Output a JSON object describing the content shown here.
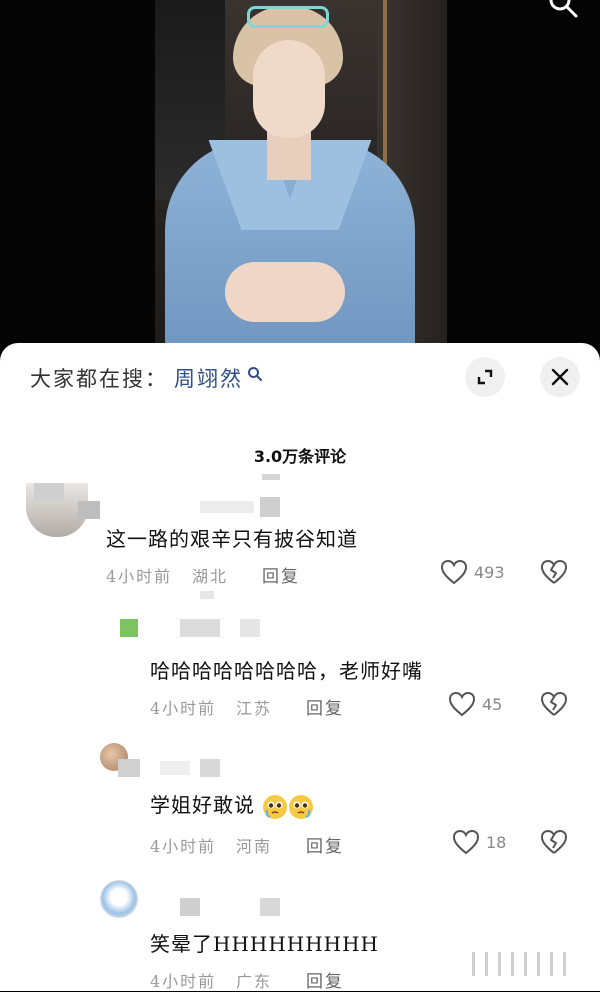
{
  "search": {
    "prefix": "大家都在搜：",
    "term": "周翊然"
  },
  "comments_header": {
    "count_label": "3.0万条评论"
  },
  "comments": [
    {
      "text": "这一路的艰辛只有披谷知道",
      "time": "4小时前",
      "location": "湖北",
      "reply_label": "回复",
      "likes": "493"
    },
    {
      "text": "哈哈哈哈哈哈哈哈，老师好嘴",
      "time": "4小时前",
      "location": "江苏",
      "reply_label": "回复",
      "likes": "45"
    },
    {
      "text": "学姐好敢说",
      "emoji": [
        "pleading-face-icon",
        "pleading-face-icon"
      ],
      "time": "4小时前",
      "location": "河南",
      "reply_label": "回复",
      "likes": "18"
    },
    {
      "text": "笑晕了HHHHHHHHH",
      "time": "4小时前",
      "location": "广东",
      "reply_label": "回复",
      "likes": ""
    }
  ],
  "colors": {
    "search_term": "#2f4e86",
    "meta_gray": "#9a9a9a",
    "button_bg": "#f0f0f0"
  }
}
